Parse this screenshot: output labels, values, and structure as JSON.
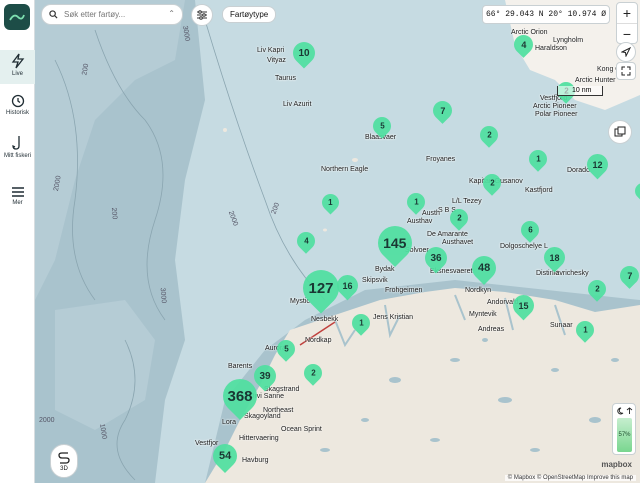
{
  "rail": {
    "items": [
      {
        "label": "Live"
      },
      {
        "label": "Historisk"
      },
      {
        "label": "Mitt fiskeri"
      },
      {
        "label": "Mer"
      }
    ]
  },
  "search": {
    "placeholder": "Søk etter fartøy..."
  },
  "filter_chip": "Fartøytype",
  "coordinates": "66° 29.043 N 20° 10.974 Ø",
  "scale_label": "10 nm",
  "time_of_day": {
    "percent_label": "57%"
  },
  "map_3d_label": "3D",
  "attribution": "© Mapbox © OpenStreetMap  Improve this map",
  "mapbox_logo": "mapbox",
  "colors": {
    "cluster": "#4fe0a0",
    "land": "#ede8df",
    "sea_shallow": "#c6dbe2",
    "sea_deep": "#a9c3cd"
  },
  "clusters": [
    {
      "count": "10"
    },
    {
      "count": "4"
    },
    {
      "count": "2"
    },
    {
      "count": "5"
    },
    {
      "count": "7"
    },
    {
      "count": "2"
    },
    {
      "count": "1"
    },
    {
      "count": "12"
    },
    {
      "count": "1"
    },
    {
      "count": "2"
    },
    {
      "count": "1"
    },
    {
      "count": "4"
    },
    {
      "count": "145"
    },
    {
      "count": "2"
    },
    {
      "count": "36"
    },
    {
      "count": "6"
    },
    {
      "count": "48"
    },
    {
      "count": "18"
    },
    {
      "count": "7"
    },
    {
      "count": "127"
    },
    {
      "count": "16"
    },
    {
      "count": "15"
    },
    {
      "count": "2"
    },
    {
      "count": "1"
    },
    {
      "count": "1"
    },
    {
      "count": "5"
    },
    {
      "count": "2"
    },
    {
      "count": "39"
    },
    {
      "count": "368"
    },
    {
      "count": "54"
    },
    {
      "count": "1"
    }
  ],
  "places": [
    "Liv Kapri",
    "Vityaz",
    "Taurus",
    "Liv Azurit",
    "Arctic Orion",
    "Lyngholm",
    "Haraldson",
    "Kong Oscar",
    "Vestfjord",
    "Arctic Pioneer",
    "Polar Pioneer",
    "Blaasvaer",
    "Froyanes",
    "Northern Eagle",
    "Kapitan Gusanov",
    "Kastfjord",
    "Dorado",
    "L/L Tezey",
    "Austhav",
    "De Amarante",
    "Austhavet",
    "Solvoer",
    "Dolgoschelye L",
    "Bydak",
    "Skipsvik",
    "Frohgeimen",
    "Eksnesvaeret",
    "Nordkyn",
    "Jens Kristian",
    "Distinkt",
    "Tavrichesky",
    "Mystic",
    "Myntevik",
    "Andorvald",
    "Sunaar",
    "Andreas",
    "Nesbekk",
    "Barents",
    "Skagstrand",
    "Orvi Sanne",
    "Northeast",
    "Skagoyland",
    "Hittervaering",
    "Havburg",
    "Vestfjor",
    "Lora",
    "S B S",
    "Austh",
    "Aurora",
    "Nordkap",
    "Ocean Sprint",
    "Arctic Hunter"
  ],
  "depth_labels": [
    "3000",
    "2000",
    "200",
    "2000",
    "200",
    "3000",
    "200",
    "2000",
    "1000"
  ]
}
